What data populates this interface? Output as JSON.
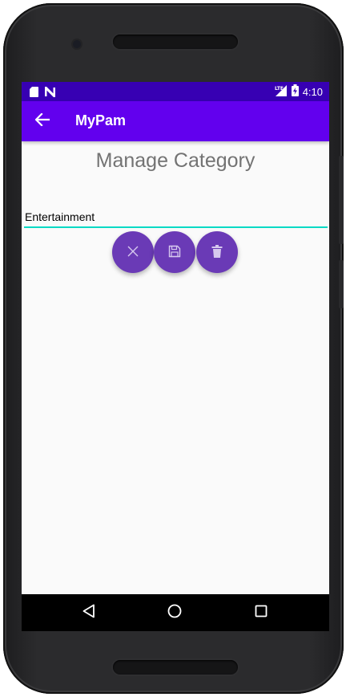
{
  "status_bar": {
    "time": "4:10",
    "network": "LTE",
    "icons": [
      "sd-card-icon",
      "n-icon",
      "lte-signal-icon",
      "battery-charging-icon"
    ]
  },
  "app_bar": {
    "title": "MyPam",
    "back_icon": "arrow-left-icon"
  },
  "main": {
    "heading": "Manage Category",
    "category_name": {
      "value": "Entertainment",
      "placeholder": ""
    },
    "actions": [
      {
        "name": "cancel",
        "icon": "close-icon"
      },
      {
        "name": "save",
        "icon": "floppy-disk-icon"
      },
      {
        "name": "delete",
        "icon": "trash-icon"
      }
    ]
  },
  "nav_bar": {
    "buttons": [
      "back-triangle-icon",
      "home-circle-icon",
      "recents-square-icon"
    ]
  },
  "colors": {
    "status_bar": "#3700b3",
    "app_bar": "#6200ee",
    "fab": "#6a3ab6",
    "input_underline": "#03dac5",
    "heading_text": "#737373"
  }
}
